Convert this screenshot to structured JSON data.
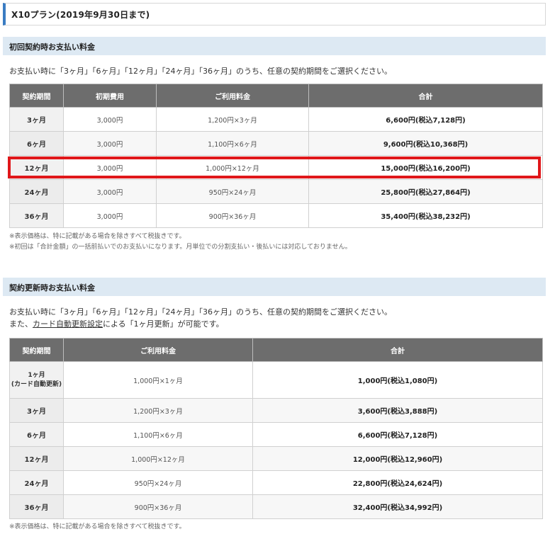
{
  "plan": {
    "title": "X10プラン(2019年9月30日まで)"
  },
  "initial": {
    "heading": "初回契約時お支払い料金",
    "intro": "お支払い時に「3ヶ月」「6ヶ月」「12ヶ月」「24ヶ月」「36ヶ月」のうち、任意の契約期間をご選択ください。",
    "columns": [
      "契約期間",
      "初期費用",
      "ご利用料金",
      "合計"
    ],
    "rows": [
      {
        "period": "3ヶ月",
        "setup": "3,000円",
        "fee": "1,200円×3ヶ月",
        "total": "6,600円(税込7,128円)"
      },
      {
        "period": "6ヶ月",
        "setup": "3,000円",
        "fee": "1,100円×6ヶ月",
        "total": "9,600円(税込10,368円)"
      },
      {
        "period": "12ヶ月",
        "setup": "3,000円",
        "fee": "1,000円×12ヶ月",
        "total": "15,000円(税込16,200円)"
      },
      {
        "period": "24ヶ月",
        "setup": "3,000円",
        "fee": "950円×24ヶ月",
        "total": "25,800円(税込27,864円)"
      },
      {
        "period": "36ヶ月",
        "setup": "3,000円",
        "fee": "900円×36ヶ月",
        "total": "35,400円(税込38,232円)"
      }
    ],
    "notes": [
      "※表示価格は、特に記載がある場合を除きすべて税抜きです。",
      "※初回は「合計金額」の一括前払いでのお支払いになります。月単位での分割支払い・後払いには対応しておりません。"
    ]
  },
  "renewal": {
    "heading": "契約更新時お支払い料金",
    "intro1": "お支払い時に「3ヶ月」「6ヶ月」「12ヶ月」「24ヶ月」「36ヶ月」のうち、任意の契約期間をご選択ください。",
    "intro2_prefix": "また、",
    "intro2_link": "カード自動更新設定",
    "intro2_suffix": "による「1ヶ月更新」が可能です。",
    "columns": [
      "契約期間",
      "ご利用料金",
      "合計"
    ],
    "rows": [
      {
        "period": "1ヶ月\n(カード自動更新)",
        "fee": "1,000円×1ヶ月",
        "total": "1,000円(税込1,080円)"
      },
      {
        "period": "3ヶ月",
        "fee": "1,200円×3ヶ月",
        "total": "3,600円(税込3,888円)"
      },
      {
        "period": "6ヶ月",
        "fee": "1,100円×6ヶ月",
        "total": "6,600円(税込7,128円)"
      },
      {
        "period": "12ヶ月",
        "fee": "1,000円×12ヶ月",
        "total": "12,000円(税込12,960円)"
      },
      {
        "period": "24ヶ月",
        "fee": "950円×24ヶ月",
        "total": "22,800円(税込24,624円)"
      },
      {
        "period": "36ヶ月",
        "fee": "900円×36ヶ月",
        "total": "32,400円(税込34,992円)"
      }
    ],
    "note": "※表示価格は、特に記載がある場合を除きすべて税抜きです。"
  },
  "colors": {
    "accent": "#3a7cc3",
    "highlight": "#e0171a",
    "header_bg": "#6d6d6d",
    "section_bg": "#dde9f3"
  }
}
